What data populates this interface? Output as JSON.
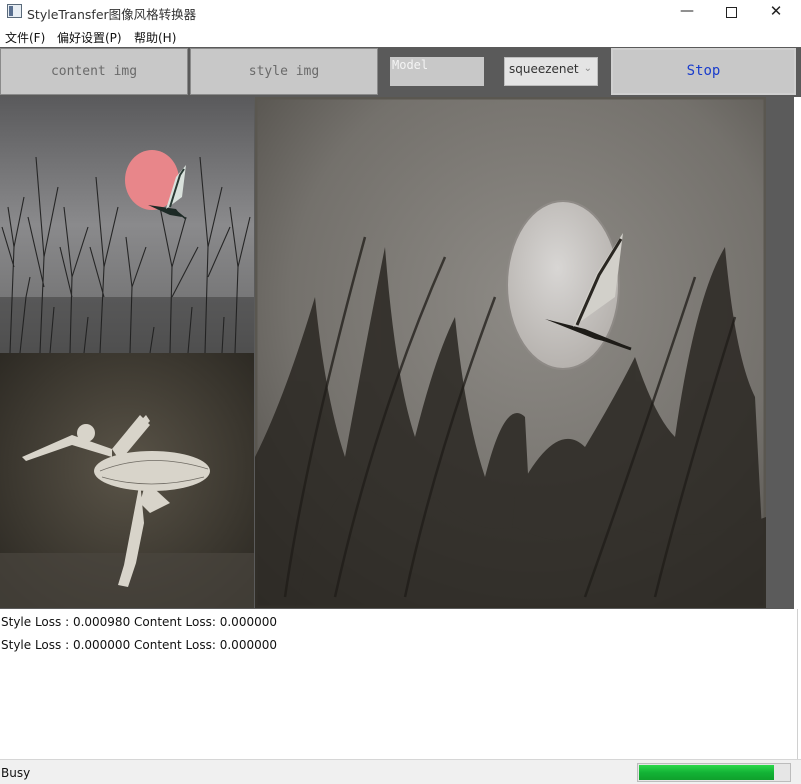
{
  "window": {
    "title": "StyleTransfer图像风格转换器",
    "minimize_glyph": "—",
    "close_glyph": "✕"
  },
  "menu": {
    "items": [
      {
        "label": "文件(F)"
      },
      {
        "label": "偏好设置(P)"
      },
      {
        "label": "帮助(H)"
      }
    ]
  },
  "toolbar": {
    "content_label": "content img",
    "style_label": "style img",
    "model_placeholder": "Model",
    "model_select_value": "squeezenet",
    "stop_label": "Stop"
  },
  "images": {
    "content": "moon-and-bird-silhouette",
    "style": "ballet-dancer",
    "result": "stylized-moon-and-bird"
  },
  "log": {
    "lines": [
      "Style Loss : 0.000980 Content Loss: 0.000000",
      "Style Loss : 0.000000 Content Loss: 0.000000"
    ]
  },
  "status": {
    "text": "Busy",
    "progress": 0.9,
    "progress_color": "#13b336"
  },
  "colors": {
    "stop_text": "#1a3dcc",
    "toolbar_bg": "#5a5a5a"
  }
}
